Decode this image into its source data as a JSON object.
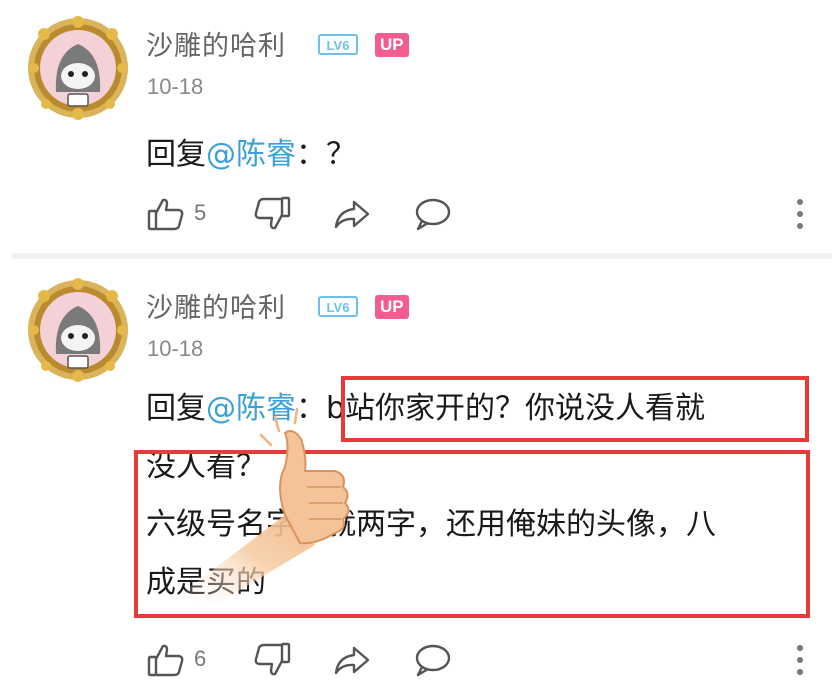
{
  "comments": [
    {
      "username": "沙雕的哈利",
      "level_badge": "LV6",
      "up_badge": "UP",
      "date": "10-18",
      "reply_prefix": "回复",
      "mention": "@陈睿",
      "content_lines": [
        "：？"
      ],
      "like_count": "5"
    },
    {
      "username": "沙雕的哈利",
      "level_badge": "LV6",
      "up_badge": "UP",
      "date": "10-18",
      "reply_prefix": "回复",
      "mention": "@陈睿",
      "first_line_rest": "：b站你家开的？你说没人看就",
      "content_lines": [
        "没人看？",
        "六级号名字还就两字，还用俺妹的头像，八",
        "成是买的"
      ],
      "like_count": "6"
    }
  ],
  "icons": {
    "like": "thumbs-up-icon",
    "dislike": "thumbs-down-icon",
    "share": "share-icon",
    "reply": "comment-icon",
    "more": "more-vertical-icon",
    "sticker": "thumbs-up-sticker"
  },
  "colors": {
    "mention": "#3aa0d8",
    "up_badge": "#f25d8e",
    "highlight": "#e83a3a"
  }
}
